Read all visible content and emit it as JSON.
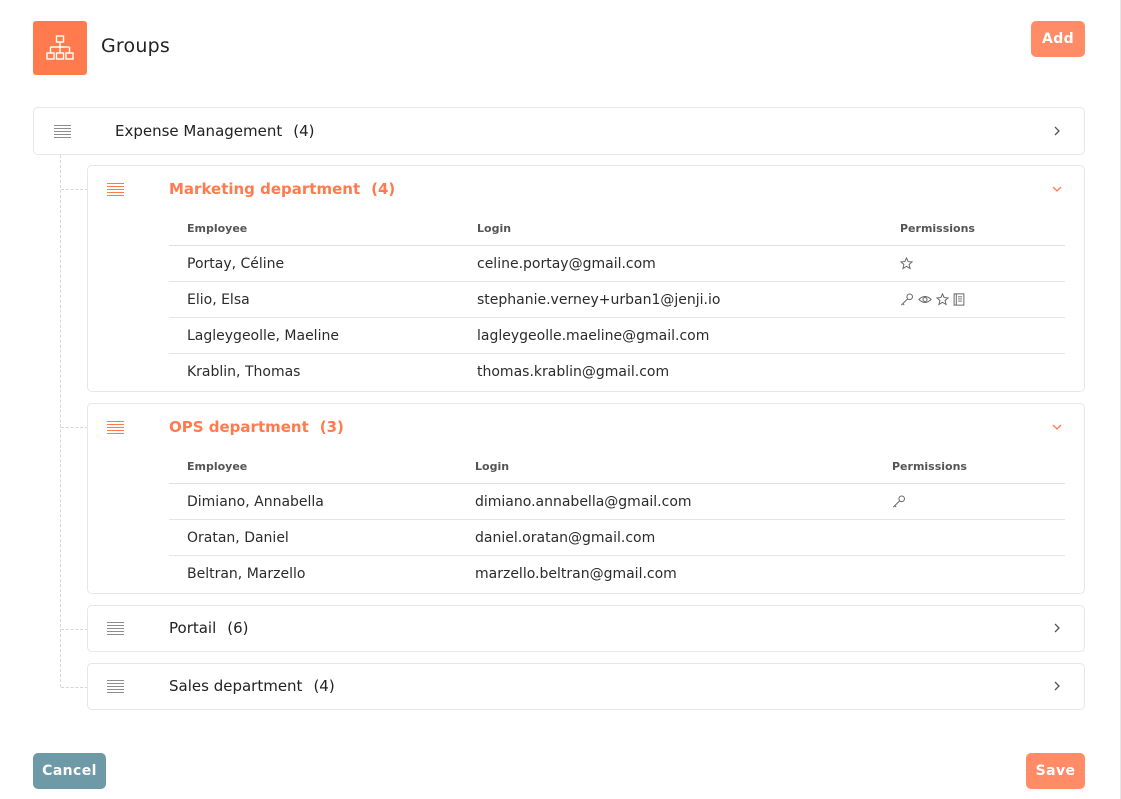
{
  "header": {
    "title": "Groups",
    "icon": "org-chart-icon",
    "add_label": "Add"
  },
  "footer": {
    "cancel_label": "Cancel",
    "save_label": "Save"
  },
  "colors": {
    "accent": "#ff7a4d",
    "button_primary": "#ff8c66",
    "button_secondary": "#6e9aa8"
  },
  "root_group": {
    "name": "Expense Management",
    "count": "(4)"
  },
  "table_headers": {
    "employee": "Employee",
    "login": "Login",
    "permissions": "Permissions"
  },
  "groups": [
    {
      "name": "Marketing department",
      "count": "(4)",
      "expanded": true,
      "rows": [
        {
          "employee": "Portay, Céline",
          "login": "celine.portay@gmail.com",
          "permissions": [
            "star-icon"
          ]
        },
        {
          "employee": "Elio, Elsa",
          "login": "stephanie.verney+urban1@jenji.io",
          "permissions": [
            "key-icon",
            "eye-icon",
            "star-icon",
            "book-icon"
          ]
        },
        {
          "employee": "Lagleygeolle, Maeline",
          "login": "lagleygeolle.maeline@gmail.com",
          "permissions": []
        },
        {
          "employee": "Krablin, Thomas",
          "login": "thomas.krablin@gmail.com",
          "permissions": []
        }
      ]
    },
    {
      "name": "OPS department",
      "count": "(3)",
      "expanded": true,
      "rows": [
        {
          "employee": "Dimiano, Annabella",
          "login": "dimiano.annabella@gmail.com",
          "permissions": [
            "key-icon"
          ]
        },
        {
          "employee": "Oratan, Daniel",
          "login": "daniel.oratan@gmail.com",
          "permissions": []
        },
        {
          "employee": "Beltran, Marzello",
          "login": "marzello.beltran@gmail.com",
          "permissions": []
        }
      ]
    },
    {
      "name": "Portail",
      "count": "(6)",
      "expanded": false,
      "rows": []
    },
    {
      "name": "Sales department",
      "count": "(4)",
      "expanded": false,
      "rows": []
    }
  ]
}
